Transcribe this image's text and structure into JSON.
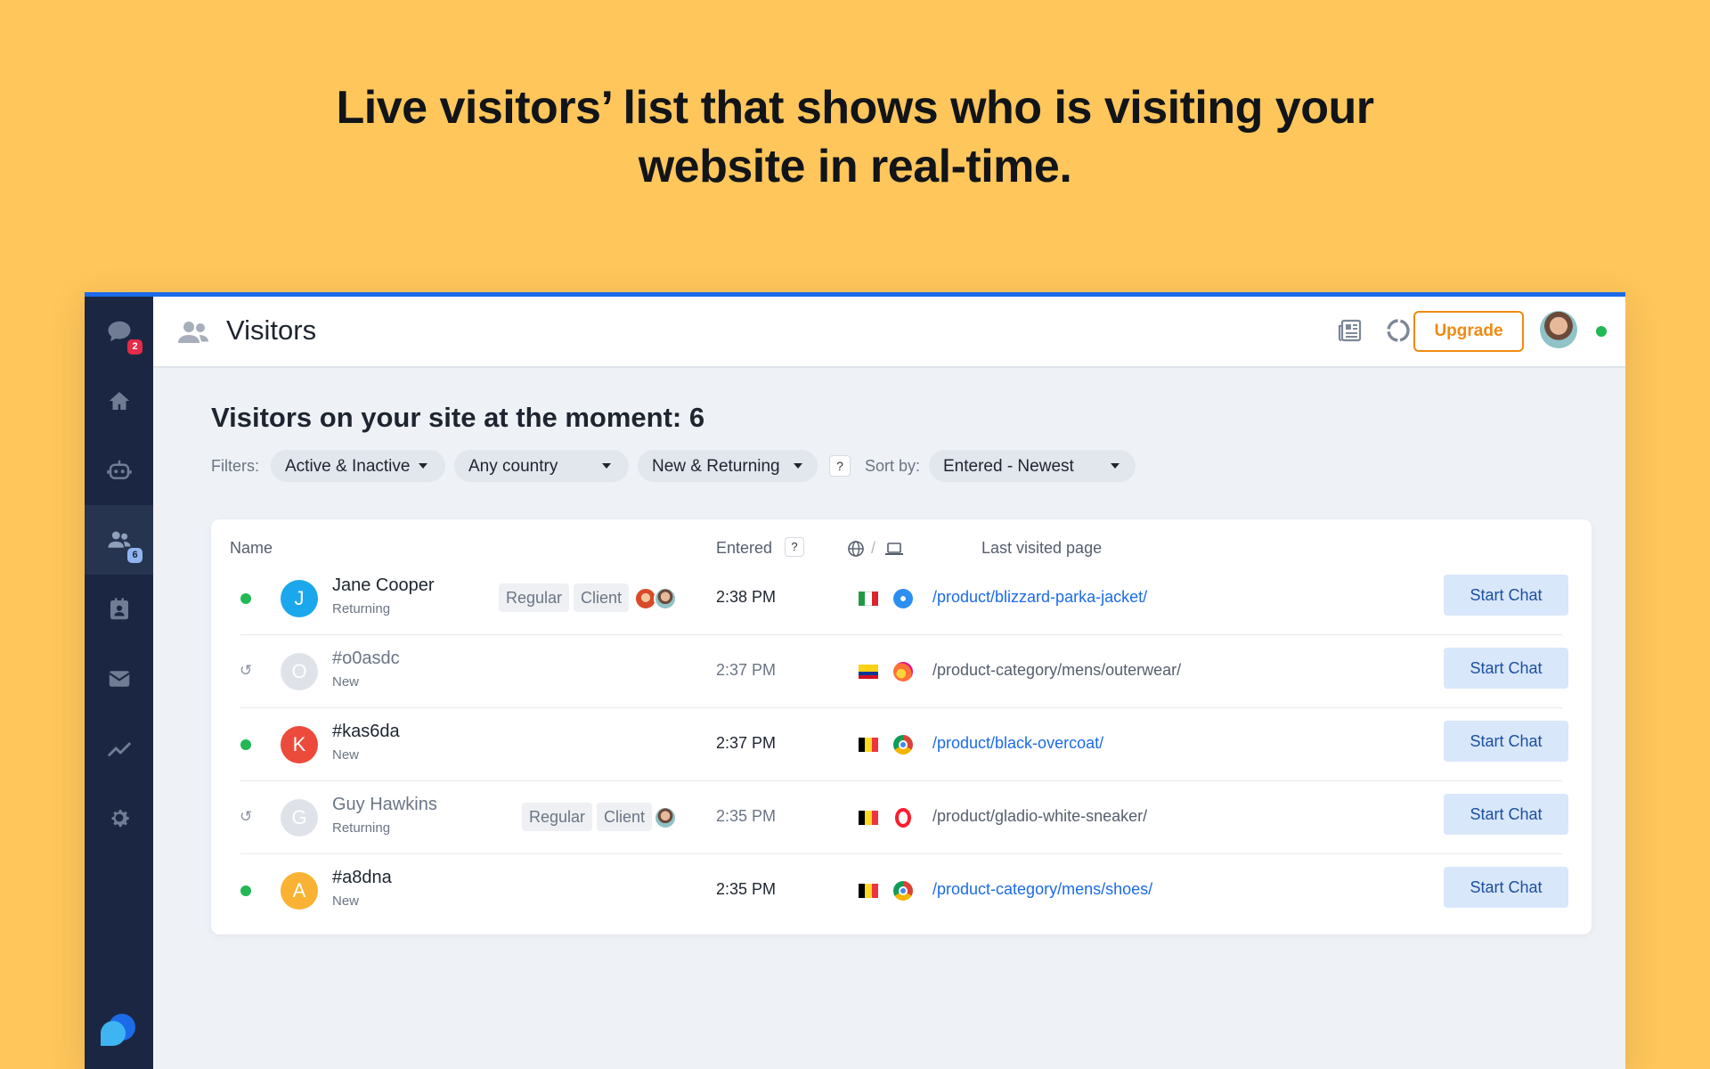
{
  "headline": {
    "line1": "Live visitors’ list that shows who is visiting your",
    "line2": "website in real-time."
  },
  "sidebar": {
    "items": [
      {
        "icon": "chat-icon",
        "badge": "2"
      },
      {
        "icon": "home-icon"
      },
      {
        "icon": "bot-icon"
      },
      {
        "icon": "visitors-icon",
        "badge": "6",
        "active": true
      },
      {
        "icon": "contacts-icon"
      },
      {
        "icon": "mail-icon"
      },
      {
        "icon": "analytics-icon"
      },
      {
        "icon": "settings-icon"
      }
    ]
  },
  "topbar": {
    "title": "Visitors",
    "upgrade_label": "Upgrade"
  },
  "main": {
    "heading": "Visitors on your site at the moment: 6",
    "filters": {
      "label": "Filters:",
      "status": "Active & Inactive",
      "country": "Any country",
      "visitor_type": "New & Returning",
      "help": "?",
      "sort_label": "Sort by:",
      "sort": "Entered - Newest"
    },
    "table": {
      "headers": {
        "name": "Name",
        "entered": "Entered",
        "entered_help": "?",
        "separator": "/",
        "last_page": "Last visited page"
      },
      "rows": [
        {
          "status": "active",
          "initial": "J",
          "avatar_color": "#1aa7ec",
          "name": "Jane Cooper",
          "type": "Returning",
          "tags": [
            "Regular",
            "Client"
          ],
          "time": "2:38 PM",
          "country": "Italy",
          "browser": "Safari",
          "page": "/product/blizzard-parka-jacket/",
          "action": "Start Chat"
        },
        {
          "status": "idle",
          "initial": "O",
          "avatar_color": "#dfe3e9",
          "name": "#o0asdc",
          "type": "New",
          "tags": [],
          "time": "2:37 PM",
          "country": "Colombia",
          "browser": "Firefox",
          "page": "/product-category/mens/outerwear/",
          "action": "Start Chat"
        },
        {
          "status": "active",
          "initial": "K",
          "avatar_color": "#ec4b3c",
          "name": "#kas6da",
          "type": "New",
          "tags": [],
          "time": "2:37 PM",
          "country": "Belgium",
          "browser": "Chrome",
          "page": "/product/black-overcoat/",
          "action": "Start Chat"
        },
        {
          "status": "idle",
          "initial": "G",
          "avatar_color": "#dfe3e9",
          "name": "Guy Hawkins",
          "type": "Returning",
          "tags": [
            "Regular",
            "Client"
          ],
          "time": "2:35 PM",
          "country": "Belgium",
          "browser": "Opera",
          "page": "/product/gladio-white-sneaker/",
          "action": "Start Chat"
        },
        {
          "status": "active",
          "initial": "A",
          "avatar_color": "#f9b233",
          "name": "#a8dna",
          "type": "New",
          "tags": [],
          "time": "2:35 PM",
          "country": "Belgium",
          "browser": "Chrome",
          "page": "/product-category/mens/shoes/",
          "action": "Start Chat"
        }
      ]
    }
  },
  "colors": {
    "background": "#FFC65B",
    "accent": "#1b6be8",
    "sidebar": "#1b2742",
    "upgrade": "#f08a12",
    "online": "#22b854"
  }
}
